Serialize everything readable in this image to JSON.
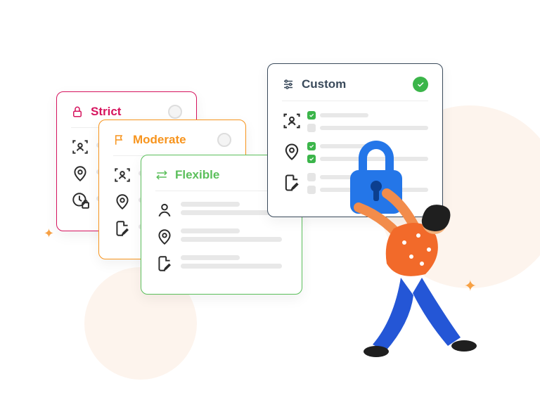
{
  "cards": {
    "strict": {
      "title": "Strict"
    },
    "moderate": {
      "title": "Moderate"
    },
    "flexible": {
      "title": "Flexible"
    },
    "custom": {
      "title": "Custom"
    }
  }
}
